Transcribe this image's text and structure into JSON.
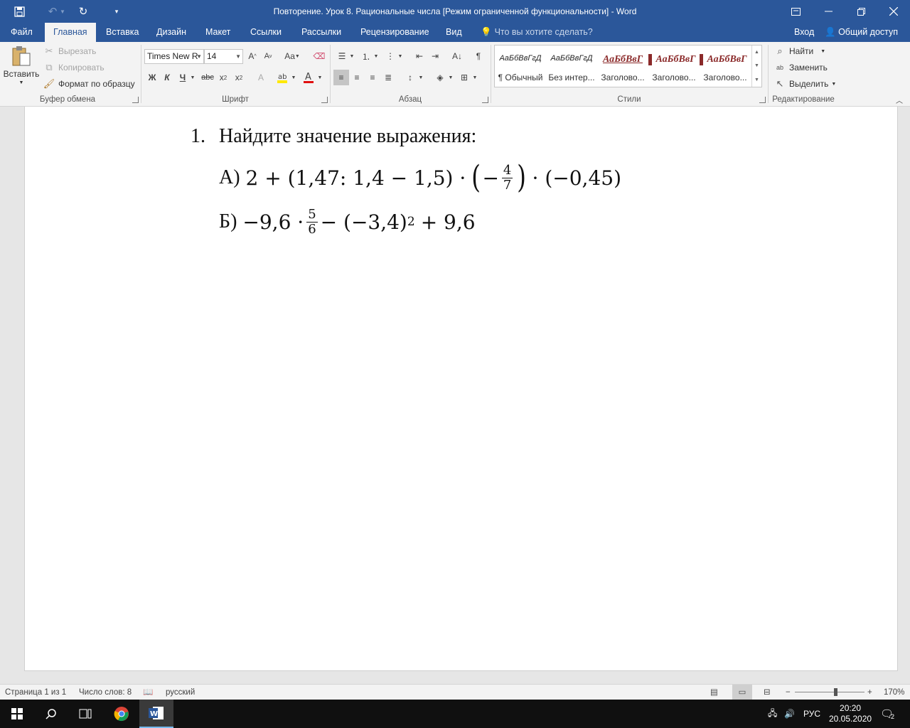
{
  "window": {
    "title": "Повторение. Урок 8. Рациональные  числа [Режим ограниченной функциональности]  -  Word",
    "signin": "Вход",
    "share": "Общий доступ"
  },
  "tabs": [
    {
      "label": "Файл"
    },
    {
      "label": "Главная"
    },
    {
      "label": "Вставка"
    },
    {
      "label": "Дизайн"
    },
    {
      "label": "Макет"
    },
    {
      "label": "Ссылки"
    },
    {
      "label": "Рассылки"
    },
    {
      "label": "Рецензирование"
    },
    {
      "label": "Вид"
    }
  ],
  "tell_me": "Что вы хотите сделать?",
  "clipboard": {
    "paste": "Вставить",
    "cut": "Вырезать",
    "copy": "Копировать",
    "format_painter": "Формат по образцу",
    "group": "Буфер обмена"
  },
  "font": {
    "name": "Times New R",
    "size": "14",
    "bold": "Ж",
    "italic": "К",
    "underline": "Ч",
    "strike": "abc",
    "group": "Шрифт"
  },
  "paragraph": {
    "group": "Абзац"
  },
  "styles": {
    "group": "Стили",
    "items": [
      {
        "preview": "АаБбВвГгД",
        "name": "¶ Обычный"
      },
      {
        "preview": "АаБбВвГгД",
        "name": "Без интер..."
      },
      {
        "preview": "АаБбВвГ",
        "name": "Заголово..."
      },
      {
        "preview": "АаБбВвГ",
        "name": "Заголово..."
      },
      {
        "preview": "АаБбВвГ",
        "name": "Заголово..."
      }
    ]
  },
  "editing": {
    "find": "Найти",
    "replace": "Заменить",
    "select": "Выделить",
    "group": "Редактирование"
  },
  "document": {
    "q_number": "1.",
    "q_text": "Найдите значение выражения:",
    "a_label": "А)",
    "a_part1": "2 + (1,47: 1,4 − 1,5) ·",
    "a_minus": "−",
    "a_frac_num": "4",
    "a_frac_den": "7",
    "a_part2": "· (−0,45)",
    "b_label": "Б)",
    "b_part1": "−9,6 ·",
    "b_frac_num": "5",
    "b_frac_den": "6",
    "b_part2": "− (−3,4)",
    "b_exp": "2",
    "b_part3": "+ 9,6"
  },
  "status": {
    "page": "Страница 1 из 1",
    "words": "Число слов: 8",
    "language": "русский",
    "zoom": "170%",
    "zoom_minus": "−",
    "zoom_plus": "+"
  },
  "taskbar": {
    "lang": "РУС",
    "time": "20:20",
    "date": "20.05.2020",
    "notifications": "2"
  }
}
